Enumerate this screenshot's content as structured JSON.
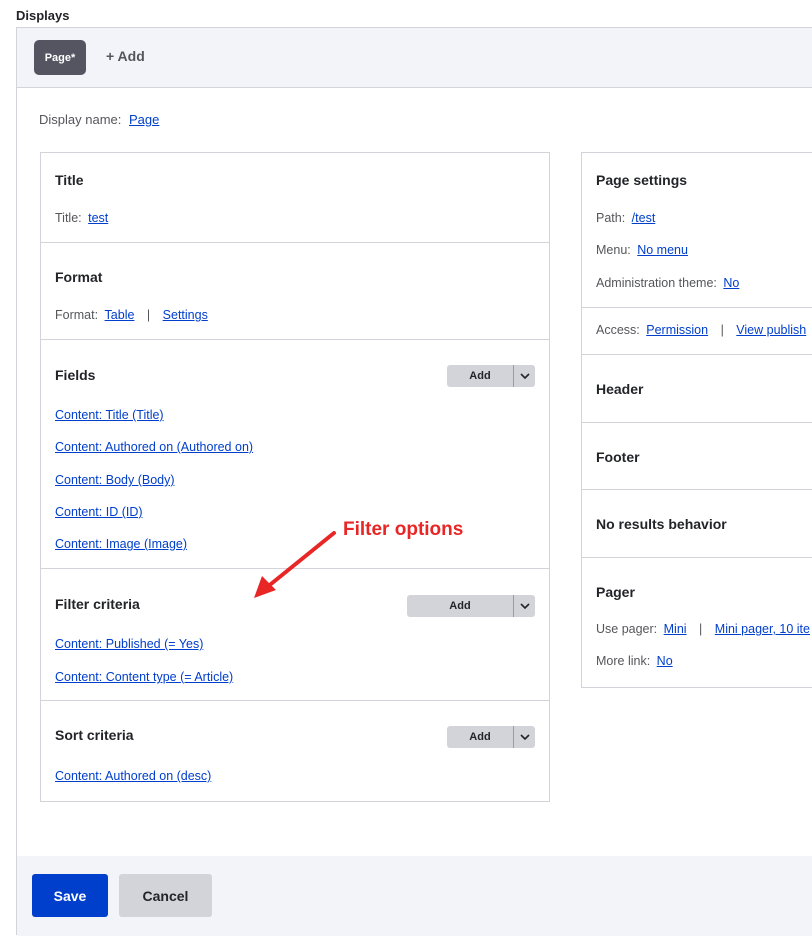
{
  "displays_label": "Displays",
  "tabs": {
    "page": "Page*",
    "add": "+ Add"
  },
  "display_name": {
    "label": "Display name:",
    "value": "Page"
  },
  "title_section": {
    "heading": "Title",
    "label": "Title:",
    "value": "test"
  },
  "format_section": {
    "heading": "Format",
    "label": "Format:",
    "value": "Table",
    "separator": "|",
    "settings": "Settings"
  },
  "fields_section": {
    "heading": "Fields",
    "add": "Add",
    "items": [
      "Content: Title (Title)",
      "Content: Authored on (Authored on)",
      "Content: Body (Body)",
      "Content: ID (ID)",
      "Content: Image (Image)"
    ]
  },
  "filter_section": {
    "heading": "Filter criteria",
    "add": "Add",
    "items": [
      "Content: Published (= Yes)",
      "Content: Content type (= Article)"
    ]
  },
  "sort_section": {
    "heading": "Sort criteria",
    "add": "Add",
    "items": [
      "Content: Authored on (desc)"
    ]
  },
  "page_settings": {
    "heading": "Page settings",
    "path_label": "Path:",
    "path_value": "/test",
    "menu_label": "Menu:",
    "menu_value": "No menu",
    "admin_label": "Administration theme:",
    "admin_value": "No",
    "access_label": "Access:",
    "access_value": "Permission",
    "separator": "|",
    "access_extra": "View publish"
  },
  "header_section": {
    "heading": "Header"
  },
  "footer_section": {
    "heading": "Footer"
  },
  "no_results_section": {
    "heading": "No results behavior"
  },
  "pager_section": {
    "heading": "Pager",
    "use_label": "Use pager:",
    "use_value": "Mini",
    "separator": "|",
    "use_extra": "Mini pager, 10 ite",
    "more_label": "More link:",
    "more_value": "No"
  },
  "buttons": {
    "save": "Save",
    "cancel": "Cancel"
  },
  "annotation": {
    "text": "Filter options",
    "color": "#e82626"
  },
  "colors": {
    "primary": "#003ecc",
    "tab_active": "#545560",
    "link": "#003ecc"
  }
}
